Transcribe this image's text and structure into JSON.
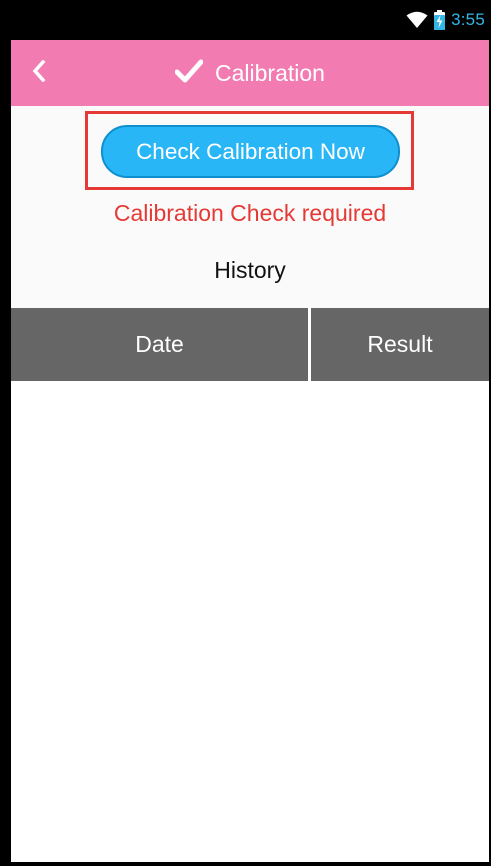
{
  "status_bar": {
    "time": "3:55",
    "icons": [
      "wifi-icon",
      "battery-charging-icon"
    ],
    "accent_color": "#33b5e5"
  },
  "app_bar": {
    "title": "Calibration",
    "back_icon": "chevron-left-icon",
    "title_icon": "checkmark-icon",
    "color": "#f27bb1"
  },
  "main": {
    "check_button_label": "Check Calibration Now",
    "warning": "Calibration Check required",
    "history_label": "History",
    "highlight_color": "#e53935",
    "button_color": "#29b6f6"
  },
  "history_table": {
    "columns": [
      "Date",
      "Result"
    ],
    "rows": []
  }
}
